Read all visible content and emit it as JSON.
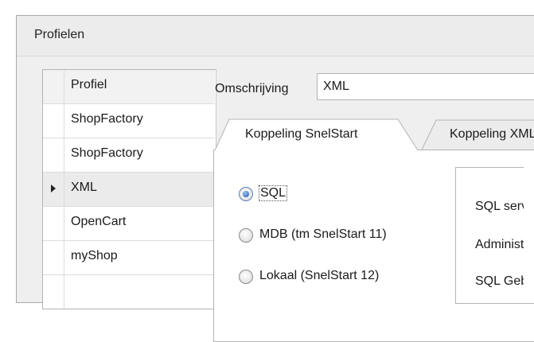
{
  "window": {
    "title": "Profielen"
  },
  "profiles_grid": {
    "header": "Profiel",
    "rows": [
      "ShopFactory",
      "ShopFactory",
      "XML",
      "OpenCart",
      "myShop"
    ],
    "selected_index": 2
  },
  "description": {
    "label": "Omschrijving",
    "value": "XML"
  },
  "tabs": [
    {
      "label": "Koppeling SnelStart",
      "active": true
    },
    {
      "label": "Koppeling XML",
      "active": false
    }
  ],
  "database_type": {
    "options": [
      "SQL",
      "MDB (tm SnelStart 11)",
      "Lokaal (SnelStart 12)"
    ],
    "selected": "SQL"
  },
  "sql_fields": [
    "SQL server",
    "Administratie",
    "SQL Gebruiker"
  ],
  "colors": {
    "window_bg": "#efefef",
    "title_bg": "#ececec",
    "border": "#b4b4b4",
    "radio_accent": "#3d73c4"
  }
}
